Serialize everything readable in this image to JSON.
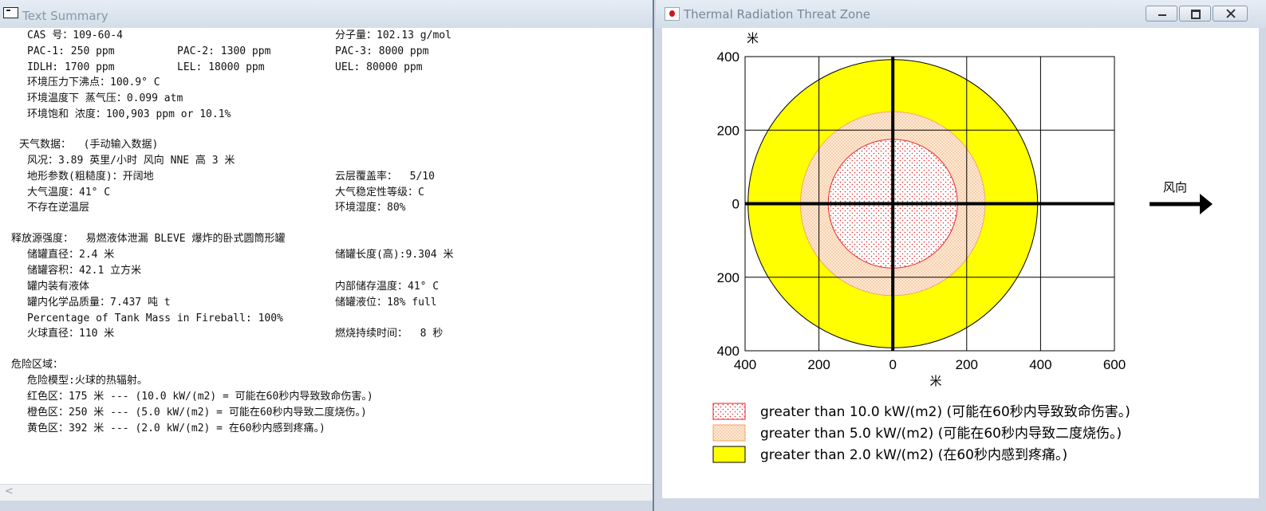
{
  "text_summary": {
    "title": "Text Summary",
    "chem_props": {
      "cas": "CAS 号：109-60-4",
      "mw": "分子量：102.13 g/mol",
      "pac1": "PAC-1: 250 ppm",
      "pac2": "PAC-2: 1300 ppm",
      "pac3": "PAC-3: 8000 ppm",
      "idlh": "IDLH: 1700 ppm",
      "lel": "LEL: 18000 ppm",
      "uel": "UEL: 80000 ppm",
      "boiling_point": "环境压力下沸点：100.9° C",
      "vapor_pressure": "环境温度下 蒸气压：0.099 atm",
      "saturation": "环境饱和 浓度：100,903 ppm or 10.1%"
    },
    "weather": {
      "heading": "天气数据：  (手动输入数据)",
      "wind": "风况：3.89 英里/小时 风向 NNE 高 3 米",
      "terrain": "地形参数(粗糙度)：开阔地",
      "cloud": "云层覆盖率：  5/10",
      "air_temp": "大气温度：41° C",
      "stability": "大气稳定性等级：C",
      "inversion": "不存在逆温层",
      "humidity": "环境湿度：80%"
    },
    "source": {
      "heading": "释放源强度：  易燃液体泄漏 BLEVE 爆炸的卧式圆筒形罐",
      "diameter": "储罐直径：2.4 米",
      "length": "储罐长度(高):9.304 米",
      "volume": "储罐容积：42.1 立方米",
      "contents": "罐内装有液体",
      "storage_temp": "内部储存温度：41° C",
      "mass": "罐内化学品质量：7.437 吨 t",
      "level": "储罐液位：18% full",
      "fireball_pct": "Percentage of Tank Mass in Fireball: 100%",
      "fireball_diameter": "火球直径：110 米",
      "burn_duration": "燃烧持续时间：  8 秒"
    },
    "hazard": {
      "heading": "危险区域：",
      "model": "危险模型:火球的热辐射。",
      "red": "红色区：175 米 --- (10.0 kW/(m2) = 可能在60秒内导致致命伤害。)",
      "orange": "橙色区：250 米 --- (5.0 kW/(m2) = 可能在60秒内导致二度烧伤。)",
      "yellow": "黄色区：392 米 --- (2.0 kW/(m2) = 在60秒内感到疼痛。)"
    },
    "scroll_left_glyph": "<"
  },
  "threat_zone": {
    "title": "Thermal Radiation Threat Zone",
    "colors": {
      "red": "#e8242a",
      "orange": "#f8dcc0",
      "yellow": "#ffff00"
    }
  },
  "chart_data": {
    "type": "area",
    "ylabel": "米",
    "xlabel": "米",
    "x_ticks": [
      "400",
      "200",
      "0",
      "200",
      "400",
      "600"
    ],
    "y_ticks": [
      "400",
      "200",
      "0",
      "200",
      "400"
    ],
    "xlim": [
      -400,
      600
    ],
    "ylim": [
      -400,
      400
    ],
    "grid": true,
    "wind_label": "风向",
    "zones": [
      {
        "name": "red",
        "radius_m": 175,
        "color": "#e8242a"
      },
      {
        "name": "orange",
        "radius_m": 250,
        "color": "#f8dcc0"
      },
      {
        "name": "yellow",
        "radius_m": 392,
        "color": "#ffff00"
      }
    ],
    "legend": [
      "greater than 10.0 kW/(m2) (可能在60秒内导致致命伤害。)",
      "greater than 5.0 kW/(m2) (可能在60秒内导致二度烧伤。)",
      "greater than 2.0 kW/(m2) (在60秒内感到疼痛。)"
    ]
  }
}
